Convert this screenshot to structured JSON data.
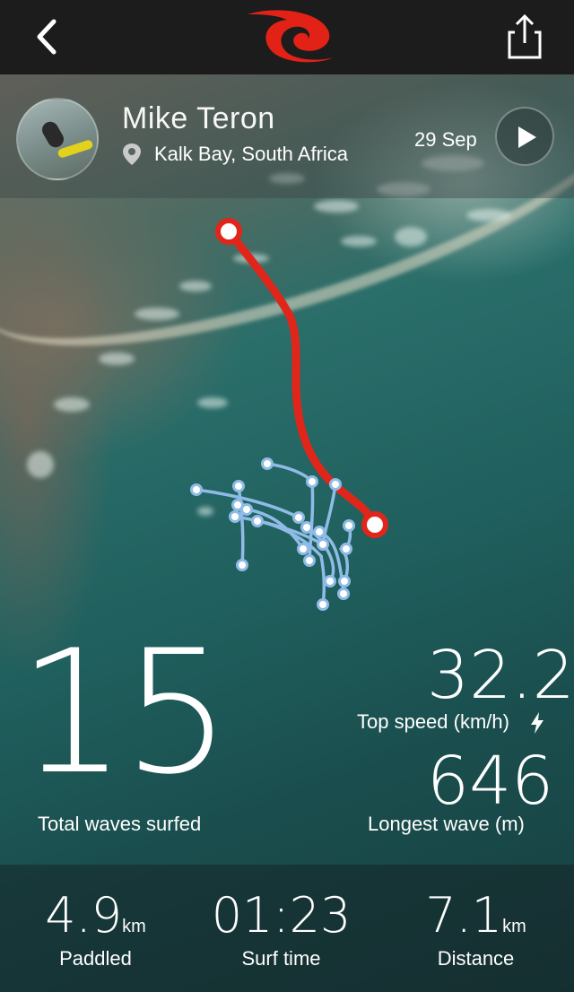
{
  "header": {
    "surfer_name": "Mike Teron",
    "location": "Kalk Bay, South Africa",
    "date": "29 Sep"
  },
  "colors": {
    "brand_red": "#e32217",
    "track_red": "#e0261a",
    "track_blue": "#8fbbe6"
  },
  "icons": {
    "back": "chevron-left-icon",
    "logo": "ripcurl-logo",
    "share": "share-icon",
    "location": "map-pin-icon",
    "play": "play-icon",
    "speed": "lightning-icon"
  },
  "stats": {
    "total_waves": {
      "value": "15",
      "label": "Total waves surfed"
    },
    "top_speed": {
      "value": "32.2",
      "label": "Top speed (km/h)"
    },
    "longest_wave": {
      "value": "646",
      "label": "Longest wave (m)"
    }
  },
  "summary": [
    {
      "value": "4.9",
      "unit": "km",
      "label": "Paddled"
    },
    {
      "value": "01:23",
      "unit": "",
      "label": "Surf time"
    },
    {
      "value": "7.1",
      "unit": "km",
      "label": "Distance"
    }
  ]
}
